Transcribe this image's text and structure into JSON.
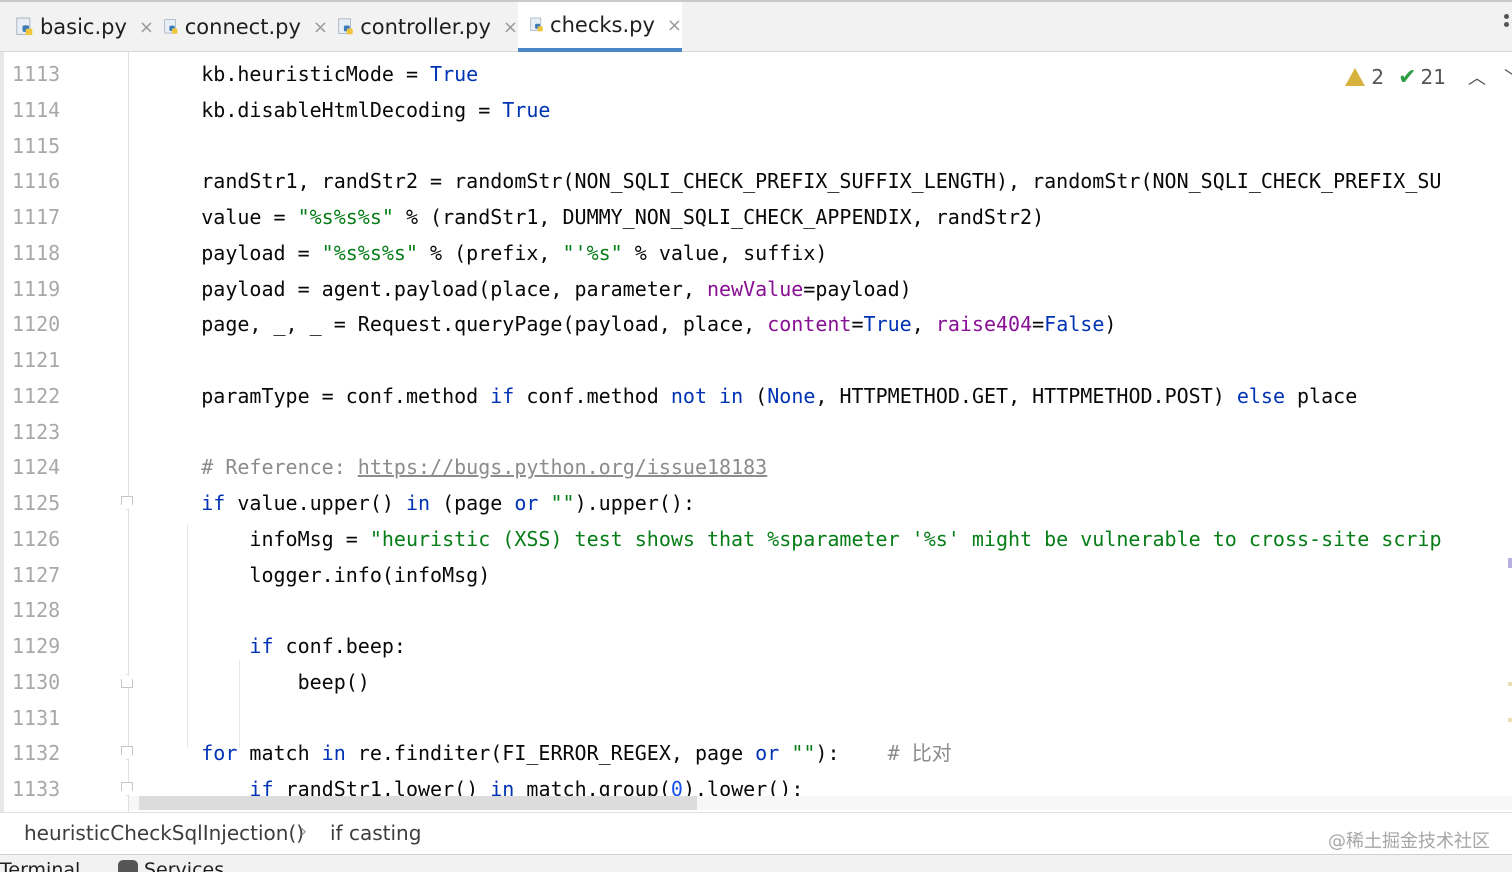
{
  "tabs": [
    {
      "label": "basic.py",
      "active": false,
      "icon": "python-file-icon"
    },
    {
      "label": "connect.py",
      "active": false,
      "icon": "python-file-icon"
    },
    {
      "label": "controller.py",
      "active": false,
      "icon": "python-file-icon"
    },
    {
      "label": "checks.py",
      "active": true,
      "icon": "python-file-icon"
    }
  ],
  "close_glyph": "×",
  "inspection": {
    "warnings": "2",
    "checks": "21",
    "warning_color": "#d8b23e",
    "check_color": "#2e9e44"
  },
  "line_numbers": [
    "1113",
    "1114",
    "1115",
    "1116",
    "1117",
    "1118",
    "1119",
    "1120",
    "1121",
    "1122",
    "1123",
    "1124",
    "1125",
    "1126",
    "1127",
    "1128",
    "1129",
    "1130",
    "1131",
    "1132",
    "1133"
  ],
  "code_lines": [
    "    kb.heuristicMode = True",
    "    kb.disableHtmlDecoding = True",
    "",
    "    randStr1, randStr2 = randomStr(NON_SQLI_CHECK_PREFIX_SUFFIX_LENGTH), randomStr(NON_SQLI_CHECK_PREFIX_SU",
    "    value = \"%s%s%s\" % (randStr1, DUMMY_NON_SQLI_CHECK_APPENDIX, randStr2)",
    "    payload = \"%s%s%s\" % (prefix, \"'%s\" % value, suffix)",
    "    payload = agent.payload(place, parameter, newValue=payload)",
    "    page, _, _ = Request.queryPage(payload, place, content=True, raise404=False)",
    "",
    "    paramType = conf.method if conf.method not in (None, HTTPMETHOD.GET, HTTPMETHOD.POST) else place",
    "",
    "    # Reference: https://bugs.python.org/issue18183",
    "    if value.upper() in (page or \"\").upper():",
    "        infoMsg = \"heuristic (XSS) test shows that %sparameter '%s' might be vulnerable to cross-site scrip",
    "        logger.info(infoMsg)",
    "",
    "        if conf.beep:",
    "            beep()",
    "",
    "    for match in re.finditer(FI_ERROR_REGEX, page or \"\"):    # 比对",
    "        if randStr1.lower() in match.group(0).lower():"
  ],
  "syntax_colors": {
    "keyword": "#0033b3",
    "string": "#067d17",
    "kwarg": "#871094",
    "comment": "#8c8c8c",
    "number": "#1750eb"
  },
  "breadcrumb": {
    "function": "heuristicCheckSqlInjection()",
    "separator": "›",
    "block": "if casting"
  },
  "watermark": "@稀土掘金技术社区",
  "bottom_tools": {
    "terminal": "Terminal",
    "services": "Services"
  }
}
